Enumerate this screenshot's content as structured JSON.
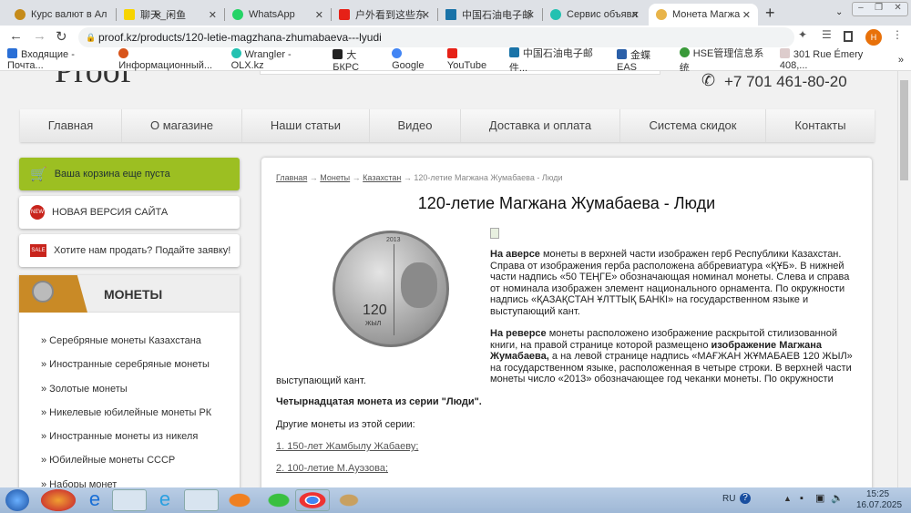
{
  "browser": {
    "tabs": [
      {
        "title": "Курс валют в Ал",
        "color": "#c58b1a"
      },
      {
        "title": "聊天_闲鱼",
        "color": "#f7d400"
      },
      {
        "title": "WhatsApp",
        "color": "#25d366"
      },
      {
        "title": "户外看到这些东",
        "color": "#e62117"
      },
      {
        "title": "中国石油电子邮",
        "color": "#1a73a8"
      },
      {
        "title": "Сервис объявл",
        "color": "#23c1b1"
      },
      {
        "title": "Монета Магжа",
        "color": "#e8b44a"
      }
    ],
    "url": "proof.kz/products/120-letie-magzhana-zhumabaeva---lyudi",
    "profile_initial": "H",
    "bookmarks": [
      {
        "label": "Входящие - Почта...",
        "color": "#2a6fd6"
      },
      {
        "label": "Информационный...",
        "color": "#d8541a"
      },
      {
        "label": "Wrangler - OLX.kz",
        "color": "#23c1b1"
      },
      {
        "label": "大БКРС",
        "color": "#222"
      },
      {
        "label": "Google",
        "color": "#4285f4"
      },
      {
        "label": "YouTube",
        "color": "#e62117"
      },
      {
        "label": "中国石油电子邮件...",
        "color": "#1a73a8"
      },
      {
        "label": "金蝶EAS",
        "color": "#2a5fa8"
      },
      {
        "label": "HSE管理信息系统",
        "color": "#3a9a3a"
      },
      {
        "label": "301 Rue Émery 408,...",
        "color": "#c9a"
      }
    ]
  },
  "site": {
    "phone": "+7 701 461-80-20",
    "nav": [
      "Главная",
      "О магазине",
      "Наши статьи",
      "Видео",
      "Доставка и оплата",
      "Система скидок",
      "Контакты"
    ],
    "cart": "Ваша корзина еще пуста",
    "new_version": "НОВАЯ ВЕРСИЯ САЙТА",
    "sell": "Хотите нам продать? Подайте заявку!",
    "coins_title": "МОНЕТЫ",
    "coin_categories": [
      "» Серебряные монеты Казахстана",
      "» Иностранные серебряные монеты",
      "» Золотые монеты",
      "» Никелевые юбилейные монеты РК",
      "» Иностранные монеты из никеля",
      "» Юбилейные монеты СССР",
      "» Наборы монет"
    ]
  },
  "product": {
    "breadcrumb": [
      "Главная",
      "Монеты",
      "Казахстан",
      "120-летие Магжана Жумабаева - Люди"
    ],
    "breadcrumb_sep": " → ",
    "title": "120-летие Магжана Жумабаева - Люди",
    "coin_year": "2013",
    "coin_value": "120",
    "coin_sub": "ЖЫЛ",
    "p1_bold": "На аверсе",
    "p1": " монеты в верхней части изображен герб Республики Казахстан. Справа от изображения герба расположена аббревиатура «ҚҰБ».  В нижней части  надпись «50 ТЕҢГЕ» обозначающая номинал монеты. Слева и справа от номинала изображен элемент национального орнамента. По окружности надпись «ҚАЗАҚСТАН ҰЛТТЫҚ БАНКІ» на государственном языке и выступающий кант.",
    "p2_bold": "На реверсе",
    "p2a": " монеты расположено изображение раскрытой стилизованной книги, на правой странице которой размещено ",
    "p2_bold2": "изображение Магжана Жумабаева,",
    "p2b": " а на левой странице надпись «МАҒЖАН  ЖҰМАБАЕВ 120 ЖЫЛ» на государственном языке, расположенная в четыре строки. В верхней части монеты число «2013» обозначающее год чеканки монеты.  По окружности",
    "p2c": "выступающий кант.",
    "series": "Четырнадцатая монета из серии \"Люди\".",
    "others_label": "Другие монеты из этой серии:",
    "links": [
      "1. 150-лет Жамбылу Жабаеву;",
      "2. 100-летие М.Ауэзова;"
    ]
  },
  "taskbar": {
    "lang": "RU",
    "time": "15:25",
    "date": "16.07.2025"
  }
}
